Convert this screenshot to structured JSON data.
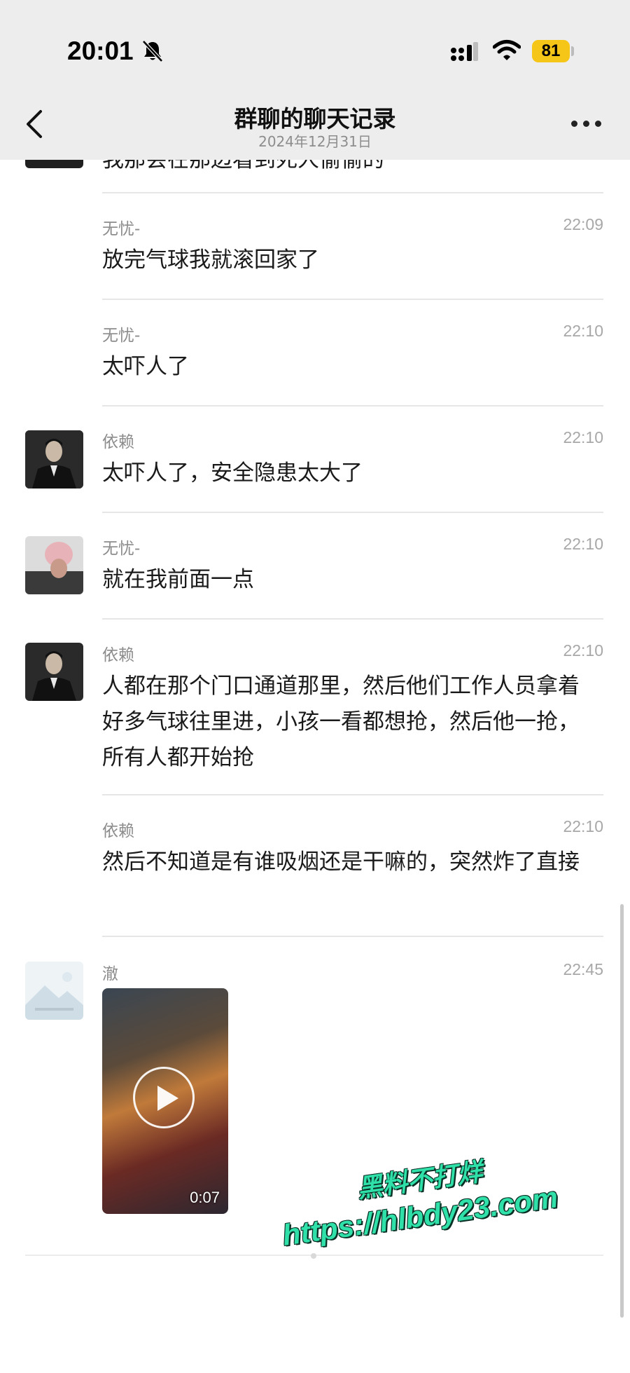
{
  "status_bar": {
    "time": "20:01",
    "battery": "81"
  },
  "nav": {
    "title": "群聊的聊天记录",
    "subtitle": "2024年12月31日"
  },
  "partial_top_text": "我那会在那边看到死人偷偷的",
  "messages": [
    {
      "sender": "无忧-",
      "time": "22:09",
      "text": "放完气球我就滚回家了"
    },
    {
      "sender": "无忧-",
      "time": "22:10",
      "text": "太吓人了"
    },
    {
      "sender": "依赖",
      "time": "22:10",
      "text": "太吓人了，安全隐患太大了"
    },
    {
      "sender": "无忧-",
      "time": "22:10",
      "text": "就在我前面一点"
    },
    {
      "sender": "依赖",
      "time": "22:10",
      "text": "人都在那个门口通道那里，然后他们工作人员拿着好多气球往里进，小孩一看都想抢，然后他一抢，所有人都开始抢"
    },
    {
      "sender": "依赖",
      "time": "22:10",
      "text": "然后不知道是有谁吸烟还是干嘛的，突然炸了直接"
    },
    {
      "sender": "澈",
      "time": "22:45",
      "video_duration": "0:07"
    }
  ],
  "watermark": {
    "line1": "黑料不打烊",
    "line2": "https://hlbdy23.com"
  }
}
